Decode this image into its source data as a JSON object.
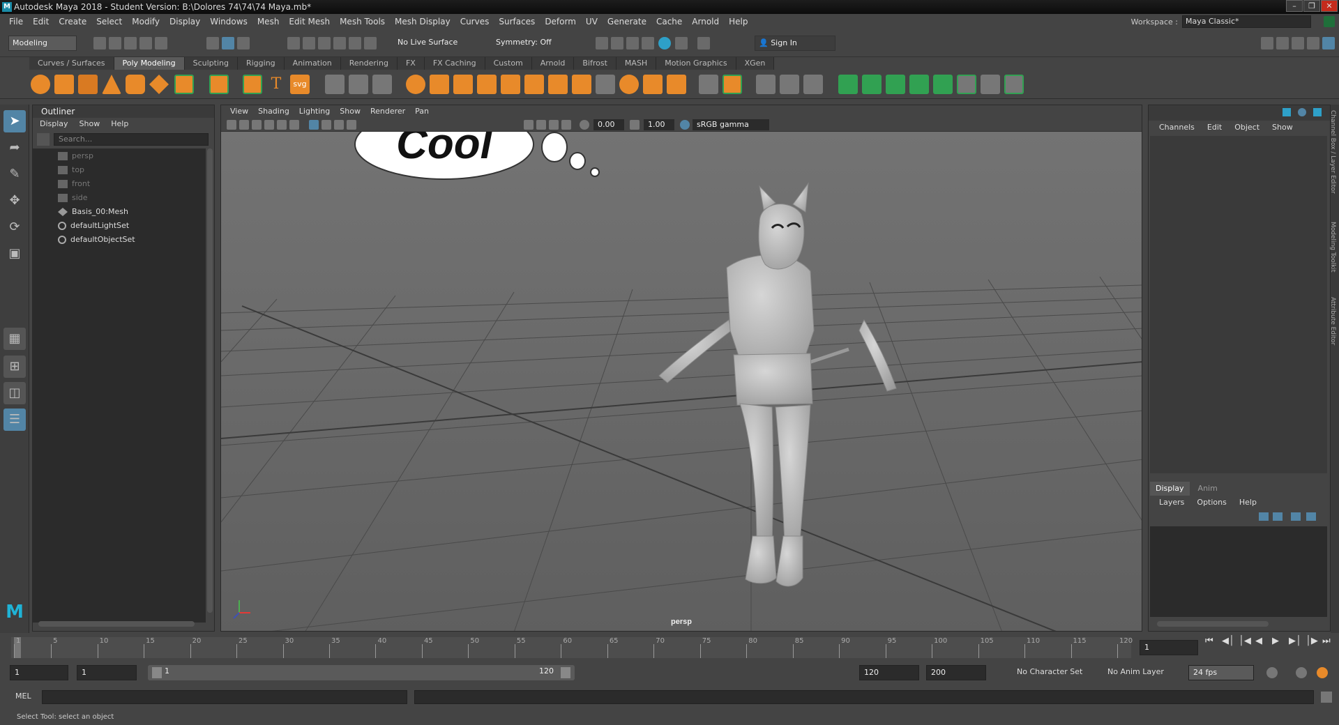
{
  "window": {
    "title": "Autodesk Maya 2018 - Student Version: B:\\Dolores 74\\74\\74 Maya.mb*",
    "logo": "M",
    "minimize": "–",
    "maximize": "❐",
    "close": "✕"
  },
  "menubar": {
    "items": [
      "File",
      "Edit",
      "Create",
      "Select",
      "Modify",
      "Display",
      "Windows",
      "Mesh",
      "Edit Mesh",
      "Mesh Tools",
      "Mesh Display",
      "Curves",
      "Surfaces",
      "Deform",
      "UV",
      "Generate",
      "Cache",
      "Arnold",
      "Help"
    ],
    "workspace_label": "Workspace :",
    "workspace_value": "Maya Classic*"
  },
  "statusline": {
    "menu_set": "Modeling",
    "live_surface": "No Live Surface",
    "symmetry": "Symmetry: Off",
    "sign_in": "Sign In"
  },
  "shelf": {
    "tabs": [
      "Curves / Surfaces",
      "Poly Modeling",
      "Sculpting",
      "Rigging",
      "Animation",
      "Rendering",
      "FX",
      "FX Caching",
      "Custom",
      "Arnold",
      "Bifrost",
      "MASH",
      "Motion Graphics",
      "XGen"
    ],
    "active_tab": "Poly Modeling",
    "text_tool": "T",
    "svg_tool": "svg"
  },
  "outliner": {
    "title": "Outliner",
    "menu": [
      "Display",
      "Show",
      "Help"
    ],
    "search_placeholder": "Search...",
    "items": [
      {
        "label": "persp",
        "kind": "camera"
      },
      {
        "label": "top",
        "kind": "camera"
      },
      {
        "label": "front",
        "kind": "camera"
      },
      {
        "label": "side",
        "kind": "camera"
      },
      {
        "label": "Basis_00:Mesh",
        "kind": "mesh"
      },
      {
        "label": "defaultLightSet",
        "kind": "set"
      },
      {
        "label": "defaultObjectSet",
        "kind": "set"
      }
    ]
  },
  "viewport": {
    "menu": [
      "View",
      "Shading",
      "Lighting",
      "Show",
      "Renderer",
      "Pan"
    ],
    "exposure": "0.00",
    "gamma": "1.00",
    "color_space": "sRGB gamma",
    "camera_label": "persp",
    "speech_text": "Cool"
  },
  "rightpanel": {
    "channel_menu": [
      "Channels",
      "Edit",
      "Object",
      "Show"
    ],
    "layer_tabs": [
      "Display",
      "Anim"
    ],
    "layer_menu": [
      "Layers",
      "Options",
      "Help"
    ],
    "side_tabs": [
      "Channel Box / Layer Editor",
      "Modeling Toolkit",
      "Attribute Editor"
    ]
  },
  "timeline": {
    "ticks": [
      "1",
      "5",
      "10",
      "15",
      "20",
      "25",
      "30",
      "35",
      "40",
      "45",
      "50",
      "55",
      "60",
      "65",
      "70",
      "75",
      "80",
      "85",
      "90",
      "95",
      "100",
      "105",
      "110",
      "115",
      "120"
    ],
    "current_frame": "1",
    "range_start_outer": "1",
    "range_start": "1",
    "range_slider_start": "1",
    "range_slider_end": "120",
    "range_end": "120",
    "range_end_outer": "200",
    "character_set": "No Character Set",
    "anim_layer": "No Anim Layer",
    "fps": "24 fps"
  },
  "command": {
    "language": "MEL",
    "help_text": "Select Tool: select an object"
  },
  "colors": {
    "accent": "#5285a6",
    "shelf_orange": "#e88a2a",
    "shelf_green": "#31a152",
    "grid_line": "#3c3c3c",
    "model_gray": "#c8c8c8"
  }
}
